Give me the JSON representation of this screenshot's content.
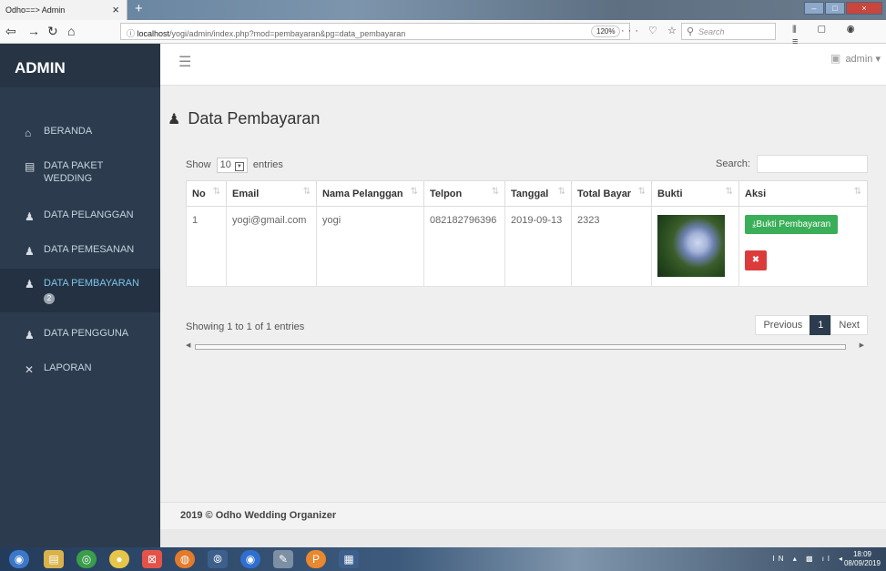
{
  "browser": {
    "tab_title": "Odho==> Admin",
    "tab_close": "×",
    "new_tab": "+",
    "url_host": "localhost",
    "url_path": "/yogi/admin/index.php?mod=pembayaran&pg=data_pembayaran",
    "zoom": "120%",
    "search_placeholder": "Search"
  },
  "sidebar": {
    "brand": "ADMIN",
    "items": [
      {
        "label": "BERANDA",
        "icon": "home-icon"
      },
      {
        "label": "DATA PAKET WEDDING",
        "icon": "file-icon"
      },
      {
        "label": "DATA PELANGGAN",
        "icon": "user-icon"
      },
      {
        "label": "DATA PEMESANAN",
        "icon": "user-icon"
      },
      {
        "label": "DATA PEMBAYARAN",
        "icon": "user-icon",
        "badge": "2",
        "active": true
      },
      {
        "label": "DATA PENGGUNA",
        "icon": "user-icon"
      },
      {
        "label": "LAPORAN",
        "icon": "tools-icon"
      }
    ]
  },
  "header": {
    "user": "admin"
  },
  "main": {
    "title": "Data Pembayaran",
    "show_label": "Show",
    "entries_value": "10",
    "entries_label": "entries",
    "search_label": "Search:",
    "columns": [
      "No",
      "Email",
      "Nama Pelanggan",
      "Telpon",
      "Tanggal",
      "Total Bayar",
      "Bukti",
      "Aksi"
    ],
    "rows": [
      {
        "no": "1",
        "email": "yogi@gmail.com",
        "nama": "yogi",
        "telpon": "082182796396",
        "tanggal": "2019-09-13",
        "total": "2323"
      }
    ],
    "bukti_button": "Bukti Pembayaran",
    "info": "Showing 1 to 1 of 1 entries",
    "pager": {
      "previous": "Previous",
      "current": "1",
      "next": "Next"
    }
  },
  "footer": {
    "text": "2019 © Odho Wedding Organizer"
  },
  "taskbar": {
    "lang": "IN",
    "time": "18:09",
    "date": "08/09/2019"
  },
  "colors": {
    "sidebar_bg": "#2c3b4d",
    "active_text": "#7fc4e8",
    "success": "#3aae58",
    "danger": "#dc3b3b"
  }
}
